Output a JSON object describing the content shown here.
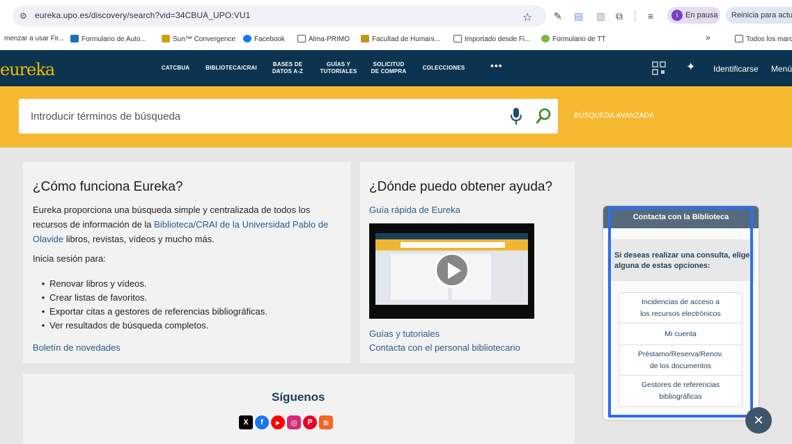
{
  "browser": {
    "url": "eureka.upo.es/discovery/search?vid=34CBUA_UPO:VU1",
    "profile_initial": "I",
    "profile_label": "En pausa",
    "restart_label": "Reinicia para actual",
    "bookmarks": [
      {
        "label": "menzar a usar Fir...",
        "color": ""
      },
      {
        "label": "Formulario de Auto...",
        "color": "#1e6fb4"
      },
      {
        "label": "Sun™ Convergence",
        "color": "#c8a416"
      },
      {
        "label": "Facebook",
        "color": "#1877f2"
      },
      {
        "label": "Alma-PRIMO",
        "color": ""
      },
      {
        "label": "Facultad de Humani...",
        "color": "#b79a1a"
      },
      {
        "label": "Importado desde Fi...",
        "color": ""
      },
      {
        "label": "Formulario de TT",
        "color": "#7ab648"
      }
    ],
    "overflow_label": "»",
    "all_bookmarks_label": "Todos los marc"
  },
  "nav": {
    "logo_text": "eureka",
    "items": [
      {
        "line1": "CATCBUA",
        "line2": ""
      },
      {
        "line1": "BIBLIOTECA/CRAI",
        "line2": ""
      },
      {
        "line1": "BASES DE",
        "line2": "DATOS A-Z"
      },
      {
        "line1": "GUÍAS Y",
        "line2": "TUTORIALES"
      },
      {
        "line1": "SOLICITUD",
        "line2": "DE COMPRA"
      },
      {
        "line1": "COLECCIONES",
        "line2": ""
      }
    ],
    "more_label": "•••",
    "login_label": "Identificarse",
    "menu_label": "Menú"
  },
  "search": {
    "placeholder": "Introducir términos de búsqueda",
    "advanced_label": "BÚSQUEDA AVANZADA"
  },
  "how_card": {
    "title": "¿Cómo funciona Eureka?",
    "intro_before": "Eureka proporciona una búsqueda simple y centralizada de todos los recursos de información de la ",
    "intro_link": "Biblioteca/CRAI de la Universidad Pablo de Olavide",
    "intro_after": " libros, revistas, vídeos y mucho más.",
    "login_prompt": "Inicia sesión para:",
    "bullets": [
      "Renovar libros y vídeos.",
      "Crear listas de favoritos.",
      "Exportar citas a gestores de referencias bibliográficas.",
      "Ver resultados de búsqueda completos."
    ],
    "news_link": "Boletín de novedades"
  },
  "help_card": {
    "title": "¿Dónde puedo obtener ayuda?",
    "quick_guide_link": "Guía rápida de Eureka",
    "guides_link": "Guías y tutoriales",
    "contact_link": "Contacta con el personal bibliotecario"
  },
  "follow": {
    "title": "Síguenos",
    "networks": [
      {
        "name": "x-icon",
        "glyph": "X",
        "color": "#000000"
      },
      {
        "name": "facebook-icon",
        "glyph": "f",
        "color": "#1877f2"
      },
      {
        "name": "youtube-icon",
        "glyph": "▶",
        "color": "#ff0000"
      },
      {
        "name": "instagram-icon",
        "glyph": "◎",
        "color": "#d62976"
      },
      {
        "name": "pinterest-icon",
        "glyph": "P",
        "color": "#e60023"
      },
      {
        "name": "rss-icon",
        "glyph": "≋",
        "color": "#f26522"
      }
    ]
  },
  "contact_widget": {
    "title": "Contacta con la Biblioteca",
    "intro": "Si deseas realizar una consulta, elige alguna de estas opciones:",
    "options": [
      {
        "line1": "Incidencias de acceso a",
        "line2": "los recursos electrónicos"
      },
      {
        "line1": "Mi cuenta",
        "line2": ""
      },
      {
        "line1": "Préstamo/Reserva/Renov.",
        "line2": "de los documentos"
      },
      {
        "line1": "Gestores de referencias",
        "line2": "bibliográficas"
      }
    ],
    "close_label": "✕"
  }
}
